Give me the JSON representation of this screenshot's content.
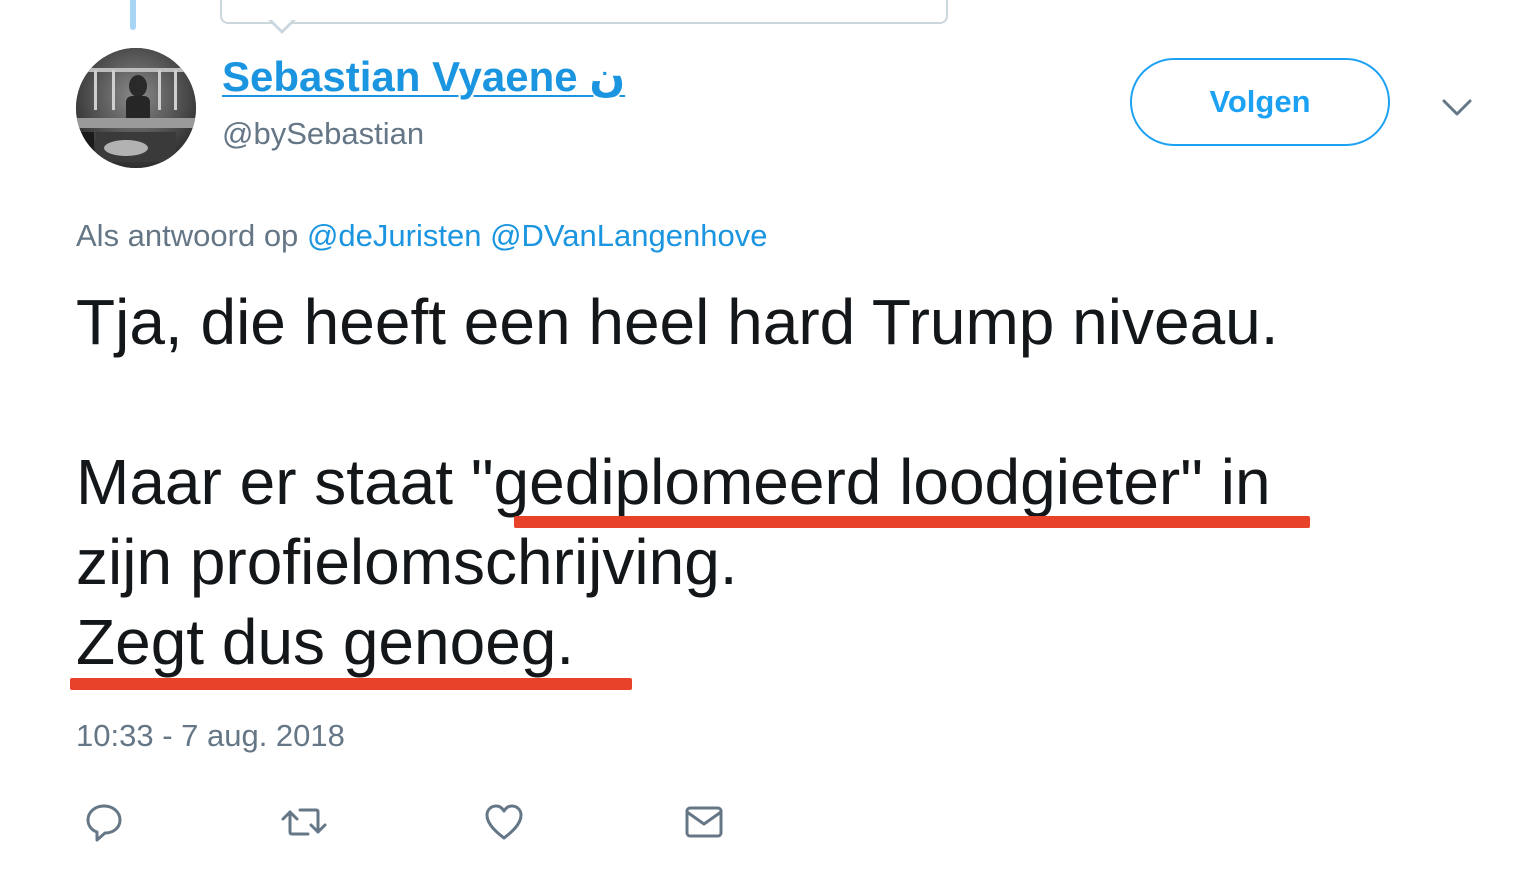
{
  "tweet": {
    "display_name": "Sebastian Vyaene",
    "name_glyph": "ن",
    "handle": "@bySebastian",
    "follow_label": "Volgen",
    "reply_prefix": "Als antwoord op",
    "reply_mentions": [
      "@deJuristen",
      "@DVanLangenhove"
    ],
    "text": {
      "line1": "Tja, die heeft een heel hard Trump niveau.",
      "line2_before": "Maar er staat ",
      "line2_highlight": "\"gediplomeerd loodgieter\"",
      "line2_after": " in",
      "line3": "zijn profielomschrijving.",
      "line4": "Zegt dus genoeg."
    },
    "timestamp": "10:33 - 7 aug. 2018"
  },
  "colors": {
    "link": "#1b95e0",
    "follow": "#1da1f2",
    "secondary_text": "#657786",
    "annotation_underline": "#e8432a"
  },
  "icons": {
    "reply": "reply-icon",
    "retweet": "retweet-icon",
    "like": "heart-icon",
    "message": "envelope-icon",
    "more": "chevron-down-icon"
  }
}
